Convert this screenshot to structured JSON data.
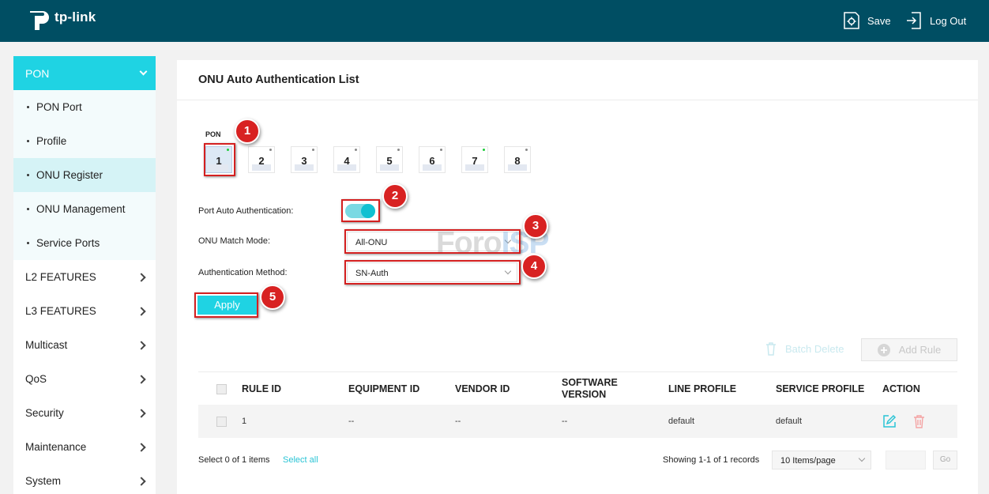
{
  "header": {
    "brand": "tp-link",
    "save_label": "Save",
    "logout_label": "Log Out"
  },
  "sidebar": {
    "top": {
      "label": "PON"
    },
    "sub_items": [
      {
        "label": "PON Port"
      },
      {
        "label": "Profile"
      },
      {
        "label": "ONU Register",
        "active": true
      },
      {
        "label": "ONU Management"
      },
      {
        "label": "Service Ports"
      }
    ],
    "items": [
      {
        "label": "L2 FEATURES"
      },
      {
        "label": "L3 FEATURES"
      },
      {
        "label": "Multicast"
      },
      {
        "label": "QoS"
      },
      {
        "label": "Security"
      },
      {
        "label": "Maintenance"
      },
      {
        "label": "System"
      }
    ]
  },
  "main": {
    "title": "ONU Auto Authentication List",
    "pon_label": "PON",
    "pon_ports": [
      {
        "label": "1",
        "selected": true,
        "link_up": true
      },
      {
        "label": "2",
        "link_up": false
      },
      {
        "label": "3",
        "link_up": false
      },
      {
        "label": "4",
        "link_up": false
      },
      {
        "label": "5",
        "link_up": false
      },
      {
        "label": "6",
        "link_up": false
      },
      {
        "label": "7",
        "link_up": true
      },
      {
        "label": "8",
        "link_up": false
      }
    ],
    "form": {
      "port_auto_auth_label": "Port Auto Authentication:",
      "port_auto_auth_enabled": true,
      "match_mode_label": "ONU Match Mode:",
      "match_mode_value": "All-ONU",
      "auth_method_label": "Authentication Method:",
      "auth_method_value": "SN-Auth",
      "apply_label": "Apply"
    },
    "watermark": {
      "part1": "Foro",
      "part2": "ISP"
    },
    "markers": [
      "1",
      "2",
      "3",
      "4",
      "5"
    ],
    "toolbar": {
      "batch_delete_label": "Batch Delete",
      "add_rule_label": "Add Rule"
    },
    "table": {
      "columns": [
        "RULE ID",
        "EQUIPMENT ID",
        "VENDOR ID",
        "SOFTWARE VERSION",
        "LINE PROFILE",
        "SERVICE PROFILE",
        "ACTION"
      ],
      "rows": [
        {
          "rule_id": "1",
          "equipment_id": "--",
          "vendor_id": "--",
          "software_version": "--",
          "line_profile": "default",
          "service_profile": "default"
        }
      ]
    },
    "footer": {
      "selection_status": "Select 0 of 1 items",
      "select_all_label": "Select all",
      "records_info": "Showing 1-1 of 1 records",
      "per_page_value": "10 Items/page",
      "go_label": "Go"
    }
  },
  "colors": {
    "header_bg": "#004e63",
    "accent": "#1fd3e3",
    "marker_red": "#d82222"
  }
}
